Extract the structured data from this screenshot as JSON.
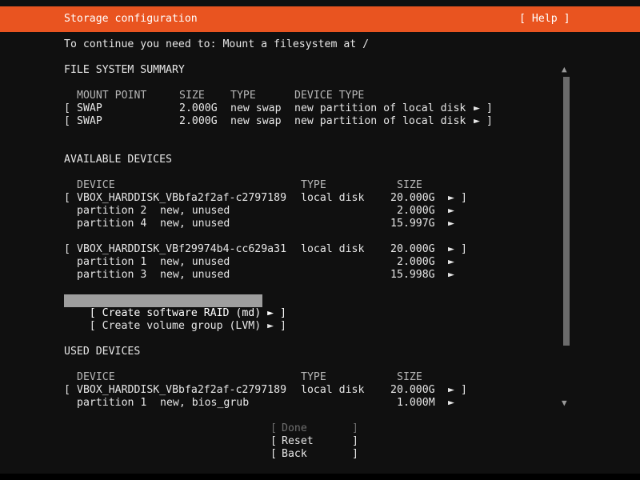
{
  "header": {
    "title": "Storage configuration",
    "help_label": "[ Help ]"
  },
  "instruction": "To continue you need to: Mount a filesystem at /",
  "fs_summary": {
    "heading": "FILE SYSTEM SUMMARY",
    "columns": [
      "MOUNT POINT",
      "SIZE",
      "TYPE",
      "DEVICE TYPE"
    ],
    "rows": [
      {
        "mount": "SWAP",
        "size": "2.000G",
        "type": "new swap",
        "device_type": "new partition of local disk"
      },
      {
        "mount": "SWAP",
        "size": "2.000G",
        "type": "new swap",
        "device_type": "new partition of local disk"
      }
    ]
  },
  "available": {
    "heading": "AVAILABLE DEVICES",
    "columns": [
      "DEVICE",
      "TYPE",
      "SIZE"
    ],
    "disks": [
      {
        "name": "VBOX_HARDDISK_VBbfa2f2af-c2797189",
        "type": "local disk",
        "size": "20.000G",
        "partitions": [
          {
            "name": "partition 2",
            "status": "new, unused",
            "size": "2.000G"
          },
          {
            "name": "partition 4",
            "status": "new, unused",
            "size": "15.997G"
          }
        ]
      },
      {
        "name": "VBOX_HARDDISK_VBf29974b4-cc629a31",
        "type": "local disk",
        "size": "20.000G",
        "partitions": [
          {
            "name": "partition 1",
            "status": "new, unused",
            "size": "2.000G"
          },
          {
            "name": "partition 3",
            "status": "new, unused",
            "size": "15.998G"
          }
        ]
      }
    ],
    "actions": {
      "raid": "Create software RAID (md)",
      "lvm": "Create volume group (LVM)"
    }
  },
  "used": {
    "heading": "USED DEVICES",
    "columns": [
      "DEVICE",
      "TYPE",
      "SIZE"
    ],
    "disk": {
      "name": "VBOX_HARDDISK_VBbfa2f2af-c2797189",
      "type": "local disk",
      "size": "20.000G"
    },
    "partition": {
      "name": "partition 1",
      "status": "new, bios_grub",
      "size": "1.000M"
    }
  },
  "buttons": {
    "done": "Done",
    "reset": "Reset",
    "back": "Back"
  },
  "glyphs": {
    "open": "[",
    "close": "]",
    "arrow": "►",
    "scroll_up": "▲",
    "scroll_down": "▼"
  },
  "colors": {
    "header_bg": "#e95420",
    "selection_bg": "#9e9e9e"
  }
}
